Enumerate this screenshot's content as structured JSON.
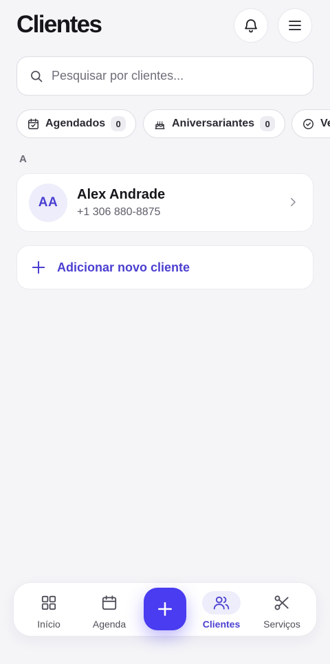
{
  "header": {
    "title": "Clientes",
    "notifications_icon": "bell-icon",
    "menu_icon": "hamburger-menu-icon"
  },
  "search": {
    "placeholder": "Pesquisar por clientes...",
    "value": ""
  },
  "filters": [
    {
      "label": "Agendados",
      "count": "0",
      "icon": "calendar-check-icon"
    },
    {
      "label": "Aniversariantes",
      "count": "0",
      "icon": "birthday-cake-icon"
    },
    {
      "label": "Ve",
      "icon": "check-circle-icon"
    }
  ],
  "clients": {
    "section_letter": "A",
    "items": [
      {
        "initials": "AA",
        "name": "Alex Andrade",
        "phone": "+1 306 880-8875"
      }
    ]
  },
  "add_client_label": "Adicionar novo cliente",
  "bottom_nav": {
    "items": [
      {
        "label": "Início",
        "icon": "grid-icon"
      },
      {
        "label": "Agenda",
        "icon": "calendar-icon"
      },
      {
        "label": "Clientes",
        "icon": "users-icon",
        "active": true
      },
      {
        "label": "Serviços",
        "icon": "scissors-icon"
      }
    ],
    "fab_icon": "plus-icon"
  },
  "colors": {
    "accent": "#4a3cf0",
    "accent_text": "#4b3fd0",
    "background": "#f5f5f8",
    "card": "#ffffff"
  }
}
